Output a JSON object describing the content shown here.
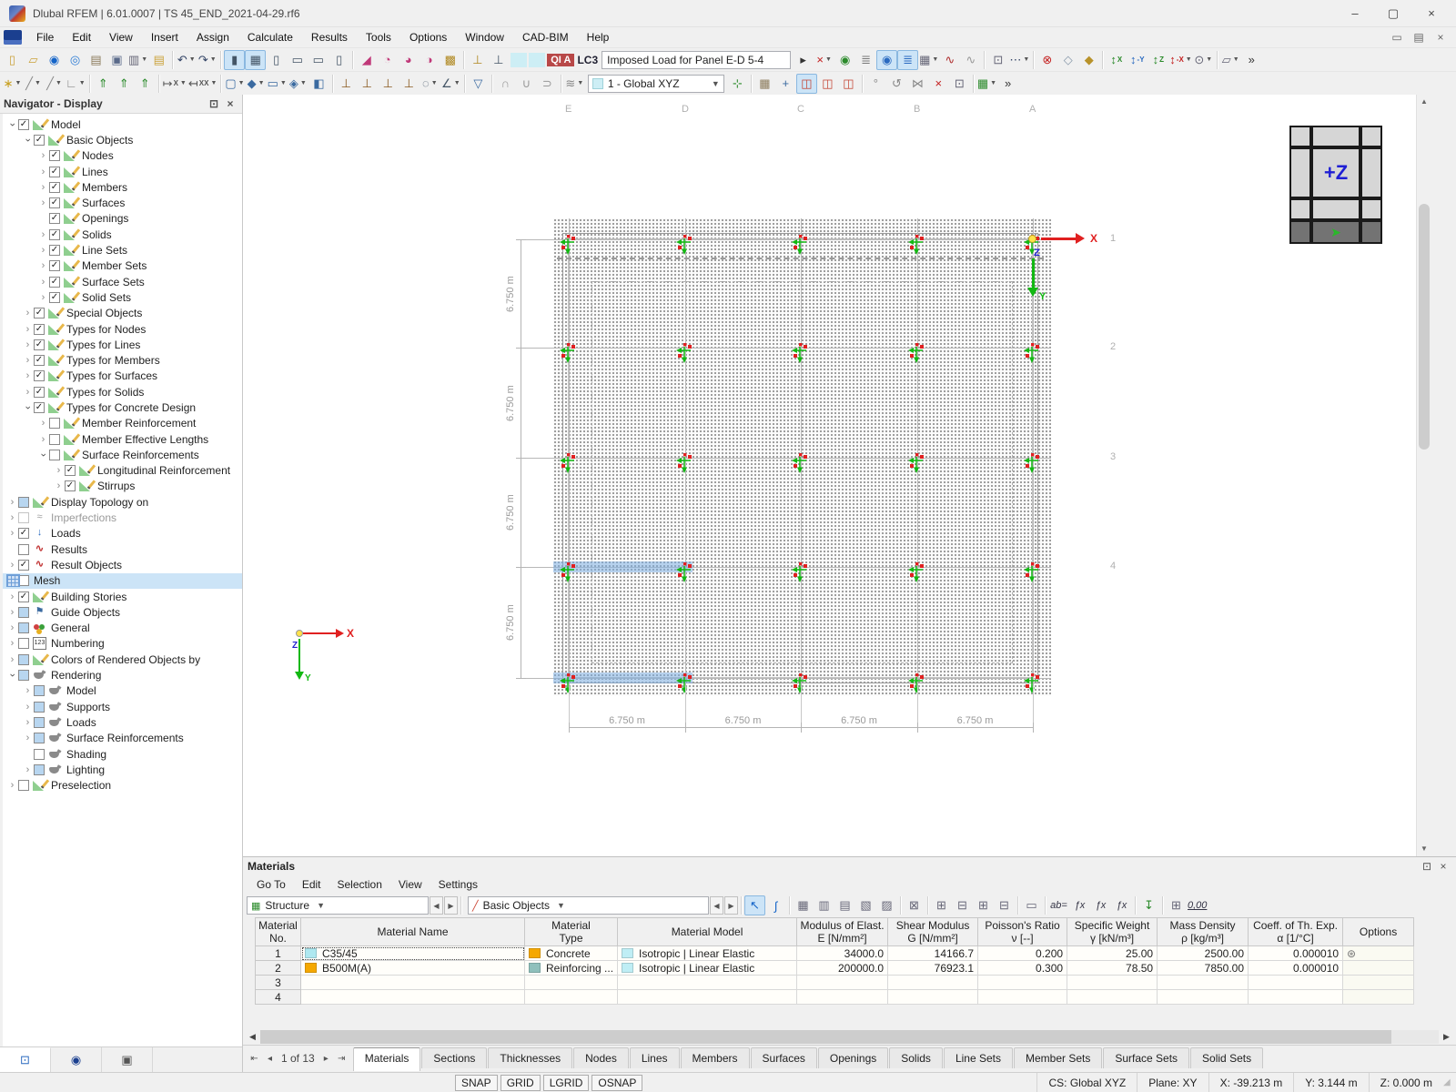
{
  "window": {
    "title": "Dlubal RFEM | 6.01.0007 | TS 45_END_2021-04-29.rf6"
  },
  "menubar": {
    "items": [
      "File",
      "Edit",
      "View",
      "Insert",
      "Assign",
      "Calculate",
      "Results",
      "Tools",
      "Options",
      "Window",
      "CAD-BIM",
      "Help"
    ]
  },
  "toolbar1": {
    "load_case": {
      "badge": "QI A",
      "id": "LC3",
      "name": "Imposed Load for Panel E-D 5-4"
    },
    "icons": [
      {
        "n": "new-model",
        "g": "▯",
        "c": "#caa23a"
      },
      {
        "n": "open-model",
        "g": "▱",
        "c": "#caa23a"
      },
      {
        "n": "dlubal-online",
        "g": "◉",
        "c": "#1464c8"
      },
      {
        "n": "network-model",
        "g": "◎",
        "c": "#2a7ad4"
      },
      {
        "n": "model-data",
        "g": "▤",
        "c": "#8a7a5a"
      },
      {
        "n": "save",
        "g": "▣",
        "c": "#5a6a8a"
      },
      {
        "n": "print",
        "g": "▥",
        "c": "#667",
        "dd": 1
      },
      {
        "n": "printout-report",
        "g": "▤",
        "c": "#caa23a"
      },
      {
        "sep": 1
      },
      {
        "n": "undo",
        "g": "↶",
        "c": "#334466",
        "dd": 1
      },
      {
        "n": "redo",
        "g": "↷",
        "c": "#334466",
        "dd": 1
      },
      {
        "sep": 1
      },
      {
        "n": "navigator-toggle",
        "g": "▮",
        "c": "#445566",
        "a": 1
      },
      {
        "n": "tables-toggle",
        "g": "▦",
        "c": "#445566",
        "a": 1
      },
      {
        "n": "panel-toggle",
        "g": "▯",
        "c": "#445566"
      },
      {
        "n": "script-panel",
        "g": "▭",
        "c": "#445566"
      },
      {
        "n": "console-panel",
        "g": "▭",
        "c": "#445566"
      },
      {
        "n": "table-panel",
        "g": "▯",
        "c": "#445566"
      },
      {
        "sep": 1
      },
      {
        "n": "new-nodal-load",
        "g": "◢",
        "c": "#c03878"
      },
      {
        "n": "new-member-load",
        "g": "◔",
        "c": "#c03878"
      },
      {
        "n": "new-area-load",
        "g": "◕",
        "c": "#c03878"
      },
      {
        "n": "new-free-load",
        "g": "◑",
        "c": "#c03878"
      },
      {
        "n": "new-load-case",
        "g": "▩",
        "c": "#b08820"
      },
      {
        "sep": 1
      },
      {
        "n": "load-transfer",
        "g": "⊥",
        "c": "#b08820"
      },
      {
        "n": "load-distribution",
        "g": "⊥",
        "c": "#445566"
      },
      {
        "lc": 1
      },
      {
        "n": "load-case-next",
        "g": "▸",
        "c": "#333333"
      },
      {
        "n": "loads-filter",
        "g": "×",
        "c": "#c42020",
        "dd": 1
      },
      {
        "n": "show-loads",
        "g": "◉",
        "c": "#2a8a2a"
      },
      {
        "n": "show-load-values",
        "g": "≣",
        "c": "#777777"
      },
      {
        "n": "display-loads",
        "g": "◉",
        "c": "#2a6ac0",
        "a": 1
      },
      {
        "n": "display-load-values",
        "g": "≣",
        "c": "#2a6ac0",
        "a": 1
      },
      {
        "n": "result-tables",
        "g": "▦",
        "c": "#667",
        "dd": 1
      },
      {
        "n": "load-ramp",
        "g": "∿",
        "c": "#b03030"
      },
      {
        "n": "load-ramp-2",
        "g": "∿",
        "c": "#999999"
      },
      {
        "sep": 1
      },
      {
        "n": "save-view",
        "g": "⊡",
        "c": "#667"
      },
      {
        "n": "visual-objects",
        "g": "⋯",
        "c": "#334466",
        "dd": 1
      },
      {
        "sep": 1
      },
      {
        "n": "zoom-reset",
        "g": "⊗",
        "c": "#c42020"
      },
      {
        "n": "isometric-view",
        "g": "◇",
        "c": "#8899aa"
      },
      {
        "n": "edit-view",
        "g": "◆",
        "c": "#b8922a"
      },
      {
        "sep": 1
      },
      {
        "n": "view-x",
        "g": "↕",
        "x": "X",
        "c": "#2a8a2a"
      },
      {
        "n": "view-minus-y",
        "g": "↕",
        "x": "-Y",
        "c": "#2a6ac0"
      },
      {
        "n": "view-z",
        "g": "↕",
        "x": "Z",
        "c": "#2a8a2a"
      },
      {
        "n": "view-minus-x",
        "g": "↕",
        "x": "-X",
        "c": "#c42020",
        "dd": 1
      },
      {
        "n": "microscope-view",
        "g": "⊙",
        "c": "#667",
        "dd": 1
      },
      {
        "sep": 1
      },
      {
        "n": "clipping-box",
        "g": "▱",
        "c": "#667",
        "dd": 1
      },
      {
        "n": "toolbar1-overflow",
        "g": "»",
        "c": "#333333"
      }
    ]
  },
  "toolbar2": {
    "cs_select": "1 - Global XYZ",
    "icons": [
      {
        "n": "new-node",
        "g": "∗",
        "c": "#c8a020",
        "dd": 1
      },
      {
        "n": "new-line",
        "g": "╱",
        "c": "#888888",
        "dd": 1
      },
      {
        "n": "new-line-type",
        "g": "╱",
        "c": "#888888",
        "dd": 1
      },
      {
        "n": "new-polyline",
        "g": "∟",
        "c": "#888888",
        "dd": 1
      },
      {
        "sep": 1
      },
      {
        "n": "new-member",
        "g": "⇑",
        "c": "#2a8a2a"
      },
      {
        "n": "new-member-set",
        "g": "⇑",
        "c": "#2a8a2a"
      },
      {
        "n": "new-section",
        "g": "⇑",
        "c": "#2a8a2a"
      },
      {
        "sep": 1
      },
      {
        "n": "dimension-x",
        "g": "↦",
        "x": "X",
        "c": "#555555",
        "dd": 1
      },
      {
        "n": "dimension-xx",
        "g": "↤",
        "x": "XX",
        "c": "#555555",
        "dd": 1
      },
      {
        "sep": 1
      },
      {
        "n": "new-surface",
        "g": "▢",
        "c": "#3a6aa0",
        "dd": 1
      },
      {
        "n": "new-solid",
        "g": "◆",
        "c": "#3a6aa0",
        "dd": 1
      },
      {
        "n": "new-opening",
        "g": "▭",
        "c": "#3a6aa0",
        "dd": 1
      },
      {
        "n": "new-plane",
        "g": "◈",
        "c": "#3a6aa0",
        "dd": 1
      },
      {
        "n": "new-block",
        "g": "◧",
        "c": "#3a6aa0"
      },
      {
        "sep": 1
      },
      {
        "n": "nodal-support",
        "g": "⊥",
        "c": "#8a5a20"
      },
      {
        "n": "line-support",
        "g": "⊥",
        "c": "#8a5a20"
      },
      {
        "n": "surface-support",
        "g": "⊥",
        "c": "#8a5a20"
      },
      {
        "n": "member-support",
        "g": "⊥",
        "c": "#8a5a20"
      },
      {
        "n": "mesh-refinement",
        "g": "◌",
        "c": "#445566",
        "dd": 1
      },
      {
        "n": "measure-tool",
        "g": "∠",
        "c": "#445566",
        "dd": 1
      },
      {
        "sep": 1
      },
      {
        "n": "selection-filter",
        "g": "▽",
        "c": "#3a6aa0"
      },
      {
        "sep": 1
      },
      {
        "n": "member-shape-1",
        "g": "∩",
        "c": "#999999"
      },
      {
        "n": "member-shape-2",
        "g": "∪",
        "c": "#999999"
      },
      {
        "n": "member-shape-3",
        "g": "⊃",
        "c": "#999999"
      },
      {
        "sep": 1
      },
      {
        "n": "guide-lines",
        "g": "≋",
        "c": "#888888",
        "dd": 1
      },
      {
        "cs": 1
      },
      {
        "n": "work-plane-origin",
        "g": "⊹",
        "c": "#2a8a2a"
      },
      {
        "sep": 1
      },
      {
        "n": "grid-settings",
        "g": "▦",
        "c": "#8a7a5a"
      },
      {
        "n": "grid-crosshair",
        "g": "+",
        "c": "#3a6aa0"
      },
      {
        "n": "plane-xy",
        "g": "◫",
        "c": "#c44433",
        "a": 1
      },
      {
        "n": "plane-yz",
        "g": "◫",
        "c": "#c44433"
      },
      {
        "n": "plane-xz",
        "g": "◫",
        "c": "#c44433"
      },
      {
        "sep": 1
      },
      {
        "n": "snap-angle",
        "g": "°",
        "c": "#888888"
      },
      {
        "n": "rotate-tool",
        "g": "↺",
        "c": "#888888"
      },
      {
        "n": "mirror-tool",
        "g": "⋈",
        "c": "#888888"
      },
      {
        "n": "delete-tool",
        "g": "×",
        "c": "#c42020"
      },
      {
        "n": "settings-tool",
        "g": "⊡",
        "c": "#667"
      },
      {
        "sep": 1
      },
      {
        "n": "table-display",
        "g": "▦",
        "c": "#2a8a2a",
        "dd": 1
      },
      {
        "n": "toolbar2-overflow",
        "g": "»",
        "c": "#333333"
      }
    ]
  },
  "navigator": {
    "title": "Navigator - Display",
    "tree": [
      {
        "label": "Model",
        "level": 0,
        "chev": "exp",
        "check": "on",
        "icon": "ruler"
      },
      {
        "label": "Basic Objects",
        "level": 1,
        "chev": "exp",
        "check": "on",
        "icon": "ruler"
      },
      {
        "label": "Nodes",
        "level": 2,
        "chev": "col",
        "check": "on",
        "icon": "ruler"
      },
      {
        "label": "Lines",
        "level": 2,
        "chev": "col",
        "check": "on",
        "icon": "ruler"
      },
      {
        "label": "Members",
        "level": 2,
        "chev": "col",
        "check": "on",
        "icon": "ruler"
      },
      {
        "label": "Surfaces",
        "level": 2,
        "chev": "col",
        "check": "on",
        "icon": "ruler"
      },
      {
        "label": "Openings",
        "level": 2,
        "chev": "none",
        "check": "on",
        "icon": "ruler"
      },
      {
        "label": "Solids",
        "level": 2,
        "chev": "col",
        "check": "on",
        "icon": "ruler"
      },
      {
        "label": "Line Sets",
        "level": 2,
        "chev": "col",
        "check": "on",
        "icon": "ruler"
      },
      {
        "label": "Member Sets",
        "level": 2,
        "chev": "col",
        "check": "on",
        "icon": "ruler"
      },
      {
        "label": "Surface Sets",
        "level": 2,
        "chev": "col",
        "check": "on",
        "icon": "ruler"
      },
      {
        "label": "Solid Sets",
        "level": 2,
        "chev": "col",
        "check": "on",
        "icon": "ruler"
      },
      {
        "label": "Special Objects",
        "level": 1,
        "chev": "col",
        "check": "on",
        "icon": "ruler"
      },
      {
        "label": "Types for Nodes",
        "level": 1,
        "chev": "col",
        "check": "on",
        "icon": "ruler"
      },
      {
        "label": "Types for Lines",
        "level": 1,
        "chev": "col",
        "check": "on",
        "icon": "ruler"
      },
      {
        "label": "Types for Members",
        "level": 1,
        "chev": "col",
        "check": "on",
        "icon": "ruler"
      },
      {
        "label": "Types for Surfaces",
        "level": 1,
        "chev": "col",
        "check": "on",
        "icon": "ruler"
      },
      {
        "label": "Types for Solids",
        "level": 1,
        "chev": "col",
        "check": "on",
        "icon": "ruler"
      },
      {
        "label": "Types for Concrete Design",
        "level": 1,
        "chev": "exp",
        "check": "on",
        "icon": "ruler"
      },
      {
        "label": "Member Reinforcement",
        "level": 2,
        "chev": "col",
        "check": "off",
        "icon": "ruler"
      },
      {
        "label": "Member Effective Lengths",
        "level": 2,
        "chev": "col",
        "check": "off",
        "icon": "ruler"
      },
      {
        "label": "Surface Reinforcements",
        "level": 2,
        "chev": "exp",
        "check": "off",
        "icon": "ruler"
      },
      {
        "label": "Longitudinal Reinforcement",
        "level": 3,
        "chev": "col",
        "check": "on",
        "icon": "ruler"
      },
      {
        "label": "Stirrups",
        "level": 3,
        "chev": "col",
        "check": "on",
        "icon": "ruler"
      },
      {
        "label": "Display Topology on",
        "level": 0,
        "chev": "col",
        "check": "part",
        "icon": "ruler"
      },
      {
        "label": "Imperfections",
        "level": 0,
        "chev": "col",
        "check": "dis",
        "icon": "imp",
        "disabled": true
      },
      {
        "label": "Loads",
        "level": 0,
        "chev": "col",
        "check": "on",
        "icon": "loads"
      },
      {
        "label": "Results",
        "level": 0,
        "chev": "none",
        "check": "off",
        "icon": "res"
      },
      {
        "label": "Result Objects",
        "level": 0,
        "chev": "col",
        "check": "on",
        "icon": "res"
      },
      {
        "label": "Mesh",
        "level": 0,
        "chev": "col",
        "check": "off",
        "icon": "mesh",
        "selected": true
      },
      {
        "label": "Building Stories",
        "level": 0,
        "chev": "col",
        "check": "on",
        "icon": "ruler"
      },
      {
        "label": "Guide Objects",
        "level": 0,
        "chev": "col",
        "check": "part",
        "icon": "guide"
      },
      {
        "label": "General",
        "level": 0,
        "chev": "col",
        "check": "part",
        "icon": "gen"
      },
      {
        "label": "Numbering",
        "level": 0,
        "chev": "col",
        "check": "off",
        "icon": "num"
      },
      {
        "label": "Colors of Rendered Objects by",
        "level": 0,
        "chev": "col",
        "check": "part",
        "icon": "ruler"
      },
      {
        "label": "Rendering",
        "level": 0,
        "chev": "exp",
        "check": "part",
        "icon": "teapot"
      },
      {
        "label": "Model",
        "level": 1,
        "chev": "col",
        "check": "part",
        "icon": "teapot"
      },
      {
        "label": "Supports",
        "level": 1,
        "chev": "col",
        "check": "part",
        "icon": "teapot"
      },
      {
        "label": "Loads",
        "level": 1,
        "chev": "col",
        "check": "part",
        "icon": "teapot"
      },
      {
        "label": "Surface Reinforcements",
        "level": 1,
        "chev": "col",
        "check": "part",
        "icon": "teapot"
      },
      {
        "label": "Shading",
        "level": 1,
        "chev": "none",
        "check": "off",
        "icon": "teapot"
      },
      {
        "label": "Lighting",
        "level": 1,
        "chev": "col",
        "check": "part",
        "icon": "teapot"
      },
      {
        "label": "Preselection",
        "level": 0,
        "chev": "col",
        "check": "off",
        "icon": "ruler"
      }
    ]
  },
  "viewport": {
    "grid_columns": [
      "E",
      "D",
      "C",
      "B",
      "A"
    ],
    "grid_rows": [
      "1",
      "2",
      "3",
      "4"
    ],
    "span_label": "6.750 m",
    "axis_x": "X",
    "axis_y": "Y",
    "axis_z": "Z",
    "viewcube_label": "+Z"
  },
  "materials": {
    "title": "Materials",
    "menu": [
      "Go To",
      "Edit",
      "Selection",
      "View",
      "Settings"
    ],
    "nav_select": "Structure",
    "filter_select": "Basic Objects",
    "toolbar_icons": [
      {
        "n": "mat-select-pointer",
        "g": "↖",
        "c": "#1464c8",
        "a": 1
      },
      {
        "n": "mat-select-related",
        "g": "∫",
        "c": "#1464c8"
      },
      {
        "sep": 1
      },
      {
        "n": "mat-view-table",
        "g": "▦",
        "c": "#667"
      },
      {
        "n": "mat-view-list",
        "g": "▥",
        "c": "#667"
      },
      {
        "n": "mat-view-compact",
        "g": "▤",
        "c": "#667"
      },
      {
        "n": "mat-view-columns",
        "g": "▧",
        "c": "#667"
      },
      {
        "n": "mat-view-details",
        "g": "▨",
        "c": "#667"
      },
      {
        "sep": 1
      },
      {
        "n": "mat-export",
        "g": "⊠",
        "c": "#667"
      },
      {
        "sep": 1
      },
      {
        "n": "mat-insert-row",
        "g": "⊞",
        "c": "#667"
      },
      {
        "n": "mat-delete-row",
        "g": "⊟",
        "c": "#667"
      },
      {
        "n": "mat-copy-row",
        "g": "⊞",
        "c": "#667"
      },
      {
        "n": "mat-move-row",
        "g": "⊟",
        "c": "#667"
      },
      {
        "sep": 1
      },
      {
        "n": "mat-frame-view",
        "g": "▭",
        "c": "#667"
      },
      {
        "sep": 1
      },
      {
        "n": "mat-rename",
        "g": "ab=",
        "text": 1
      },
      {
        "n": "mat-formula",
        "g": "ƒx",
        "text": 1
      },
      {
        "n": "mat-formula-edit",
        "g": "ƒx",
        "text": 1
      },
      {
        "n": "mat-formula-all",
        "g": "ƒx",
        "text": 1
      },
      {
        "sep": 1
      },
      {
        "n": "mat-import",
        "g": "↧",
        "c": "#2a8a2a"
      },
      {
        "sep": 1
      },
      {
        "n": "mat-units",
        "g": "⊞",
        "c": "#667"
      },
      {
        "n": "mat-decimals",
        "g": "0,00",
        "text": 1,
        "u": 1
      }
    ],
    "columns": [
      [
        "Material",
        "No."
      ],
      [
        "Material Name",
        ""
      ],
      [
        "Material",
        "Type"
      ],
      [
        "Material Model",
        ""
      ],
      [
        "Modulus of Elast.",
        "E [N/mm²]"
      ],
      [
        "Shear Modulus",
        "G [N/mm²]"
      ],
      [
        "Poisson's Ratio",
        "ν [--]"
      ],
      [
        "Specific Weight",
        "γ [kN/m³]"
      ],
      [
        "Mass Density",
        "ρ [kg/m³]"
      ],
      [
        "Coeff. of Th. Exp.",
        "α [1/°C]"
      ],
      [
        "Options",
        ""
      ]
    ],
    "rows": [
      {
        "no": "1",
        "name": "C35/45",
        "name_sw": "#aee8f0",
        "type": "Concrete",
        "type_sw": "#f5a800",
        "model": "Isotropic | Linear Elastic",
        "model_sw": "#bfeef5",
        "e": "34000.0",
        "g": "14166.7",
        "nu": "0.200",
        "gamma": "25.00",
        "rho": "2500.00",
        "alpha": "0.000010",
        "options": "gear",
        "selected": true
      },
      {
        "no": "2",
        "name": "B500M(A)",
        "name_sw": "#f5a800",
        "type": "Reinforcing ...",
        "type_sw": "#8fc0bc",
        "model": "Isotropic | Linear Elastic",
        "model_sw": "#bfeef5",
        "e": "200000.0",
        "g": "76923.1",
        "nu": "0.300",
        "gamma": "78.50",
        "rho": "7850.00",
        "alpha": "0.000010"
      },
      {
        "no": "3"
      },
      {
        "no": "4"
      }
    ],
    "pager": "1 of 13",
    "tabs": [
      "Materials",
      "Sections",
      "Thicknesses",
      "Nodes",
      "Lines",
      "Members",
      "Surfaces",
      "Openings",
      "Solids",
      "Line Sets",
      "Member Sets",
      "Surface Sets",
      "Solid Sets"
    ],
    "active_tab": "Materials"
  },
  "statusbar": {
    "toggles": [
      "SNAP",
      "GRID",
      "LGRID",
      "OSNAP"
    ],
    "cs": "CS: Global XYZ",
    "plane": "Plane: XY",
    "coord_x": "X: -39.213 m",
    "coord_y": "Y: 3.144 m",
    "coord_z": "Z: 0.000 m"
  }
}
